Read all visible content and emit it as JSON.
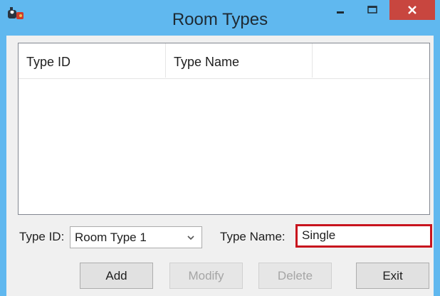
{
  "window": {
    "title": "Room Types",
    "controls": {
      "minimize": "minimize-icon",
      "maximize": "maximize-icon",
      "close": "close-icon"
    },
    "colors": {
      "title_bar": "#60b8ef",
      "close_button": "#c8463f",
      "focus_border": "#c8141e"
    }
  },
  "list": {
    "columns": [
      "Type ID",
      "Type Name",
      ""
    ],
    "rows": []
  },
  "form": {
    "type_id_label": "Type ID:",
    "type_id_value": "Room Type 1",
    "type_name_label": "Type Name:",
    "type_name_value": "Single"
  },
  "buttons": {
    "add": "Add",
    "modify": "Modify",
    "delete": "Delete",
    "exit": "Exit"
  }
}
